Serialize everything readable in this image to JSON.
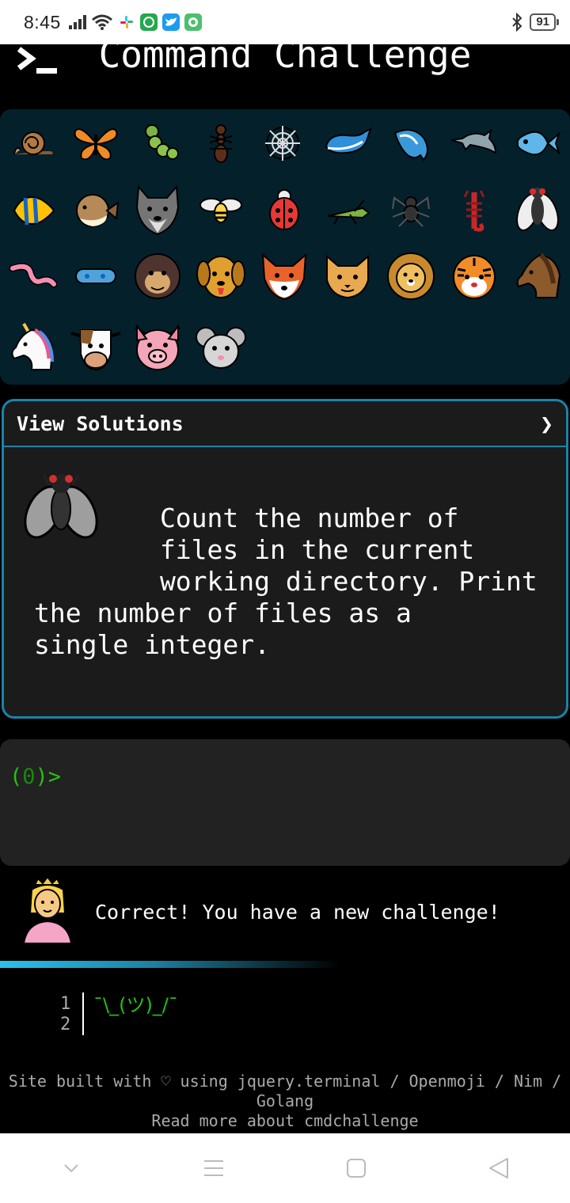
{
  "status_bar": {
    "time": "8:45",
    "battery": "91"
  },
  "header": {
    "title": "Command Challenge"
  },
  "emoji_grid": {
    "items": [
      "snail",
      "butterfly",
      "caterpillar",
      "ant",
      "spider-web",
      "whale",
      "spouting-whale",
      "dolphin",
      "fish",
      "tropical-fish",
      "blowfish",
      "wolf",
      "bee",
      "ladybug",
      "cricket",
      "spider",
      "scorpion",
      "fly",
      "worm",
      "microbe",
      "gorilla",
      "dog",
      "fox",
      "cat",
      "lion",
      "tiger",
      "horse",
      "unicorn",
      "cow",
      "pig",
      "mouse"
    ]
  },
  "solutions_card": {
    "title": "View Solutions",
    "chevron": "❯",
    "challenge_text": "        Count the number of\n        files in the current\n        working directory. Print\nthe number of files as a\nsingle integer."
  },
  "terminal": {
    "prompt_open": "(",
    "prompt_count": "0",
    "prompt_close": ")>"
  },
  "feedback": {
    "message": "Correct! You have a new challenge!"
  },
  "output": {
    "line_numbers": [
      "1",
      "2"
    ],
    "text": "¯\\_(ツ)_/¯"
  },
  "footer": {
    "line1": "Site built with ♡ using jquery.terminal / Openmoji / Nim / Golang",
    "line2": "Read more about cmdchallenge"
  },
  "colors": {
    "accent": "#1b83a8",
    "prompt_green": "#22c40d",
    "panel_bg": "#04202b"
  }
}
